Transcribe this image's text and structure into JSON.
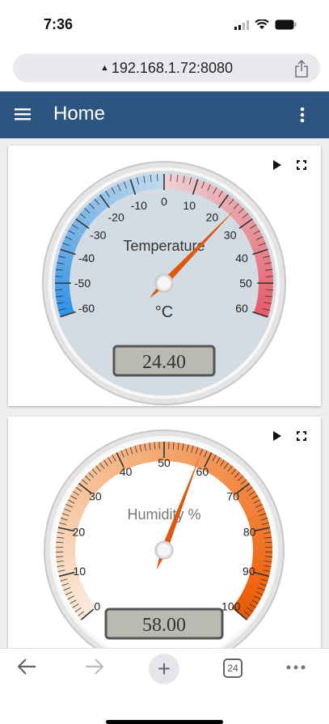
{
  "status_bar": {
    "time": "7:36"
  },
  "browser": {
    "url": "192.168.1.72:8080",
    "tab_count": "24"
  },
  "app_bar": {
    "title": "Home"
  },
  "gauges": [
    {
      "title": "Temperature",
      "units": "°C",
      "value": 24.4,
      "display": "24.40",
      "min": -60,
      "max": 60,
      "labels": [
        "-60",
        "-50",
        "-40",
        "-30",
        "-20",
        "-10",
        "0",
        "10",
        "20",
        "30",
        "40",
        "50",
        "60"
      ]
    },
    {
      "title": "Humidity %",
      "units": "",
      "value": 58,
      "display": "58.00",
      "min": 0,
      "max": 100,
      "labels": [
        "0",
        "10",
        "20",
        "30",
        "40",
        "50",
        "60",
        "70",
        "80",
        "90",
        "100"
      ]
    }
  ],
  "colors": {
    "appbar": "#2e5580",
    "needle": "#e0570f"
  }
}
